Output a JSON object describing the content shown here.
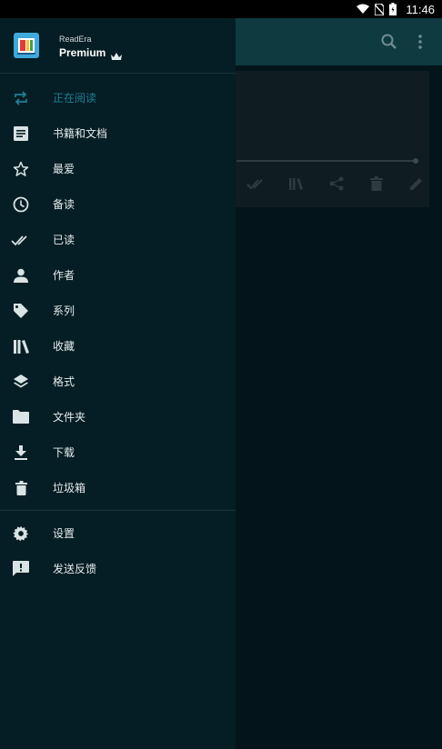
{
  "status_bar": {
    "time": "11:46",
    "icons": [
      "wifi-icon",
      "sim-off-icon",
      "battery-icon"
    ]
  },
  "app": {
    "brand_small": "ReadEra",
    "brand_big": "Premium",
    "toolbar_icons": [
      "search-icon",
      "more-vert-icon"
    ]
  },
  "drawer": {
    "items": [
      {
        "label": "正在阅读",
        "icon": "repeat-icon",
        "active": true
      },
      {
        "label": "书籍和文档",
        "icon": "document-icon"
      },
      {
        "label": "最爱",
        "icon": "star-icon"
      },
      {
        "label": "备读",
        "icon": "clock-icon"
      },
      {
        "label": "已读",
        "icon": "double-check-icon"
      },
      {
        "label": "作者",
        "icon": "person-icon"
      },
      {
        "label": "系列",
        "icon": "tag-icon"
      },
      {
        "label": "收藏",
        "icon": "library-icon"
      },
      {
        "label": "格式",
        "icon": "layers-icon"
      },
      {
        "label": "文件夹",
        "icon": "folder-icon"
      },
      {
        "label": "下载",
        "icon": "download-icon"
      },
      {
        "label": "垃圾箱",
        "icon": "trash-icon"
      }
    ],
    "secondary": [
      {
        "label": "设置",
        "icon": "gear-icon"
      },
      {
        "label": "发送反馈",
        "icon": "feedback-icon"
      }
    ]
  },
  "colors": {
    "drawer_bg": "#051d24",
    "appbar_bg": "#0e3a40",
    "active_text": "#1d7f96",
    "icon_color": "#d9e2e4"
  }
}
